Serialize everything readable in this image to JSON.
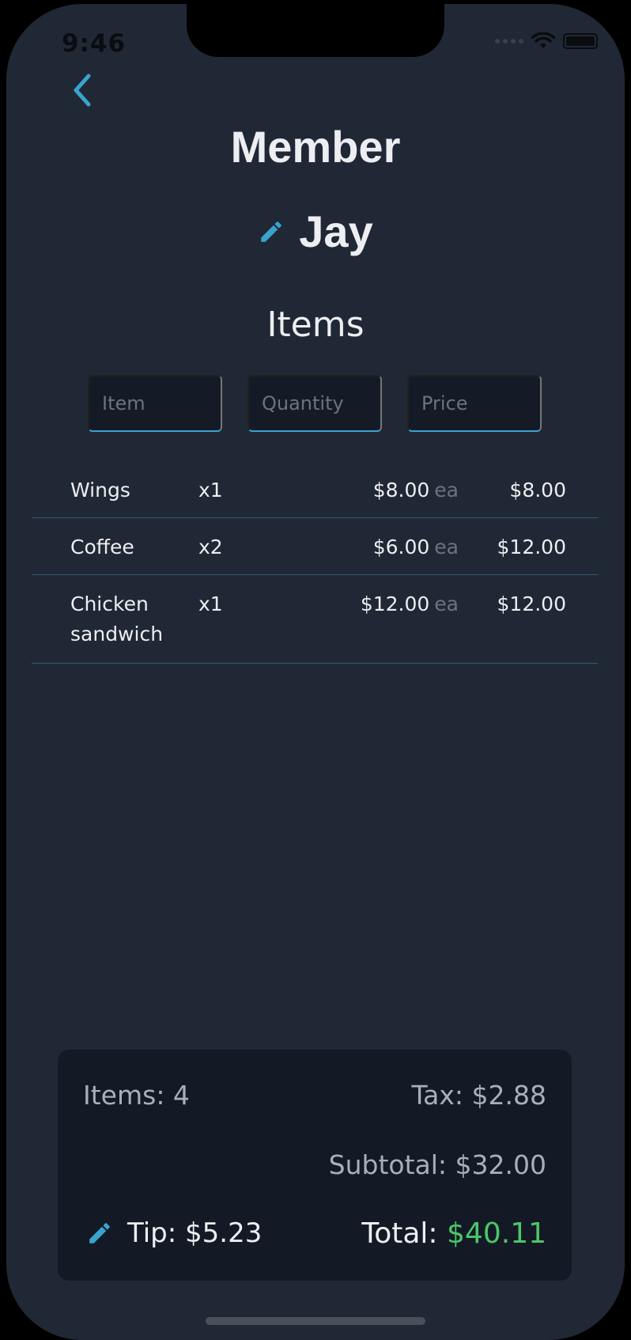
{
  "status": {
    "time": "9:46"
  },
  "header": {
    "title": "Member",
    "member_name": "Jay"
  },
  "items_section": {
    "title": "Items"
  },
  "inputs": {
    "item_placeholder": "Item",
    "quantity_placeholder": "Quantity",
    "price_placeholder": "Price"
  },
  "items": [
    {
      "name": "Wings",
      "qty": "x1",
      "price": "$8.00",
      "unit": "ea",
      "total": "$8.00"
    },
    {
      "name": "Coffee",
      "qty": "x2",
      "price": "$6.00",
      "unit": "ea",
      "total": "$12.00"
    },
    {
      "name": "Chicken sandwich",
      "qty": "x1",
      "price": "$12.00",
      "unit": "ea",
      "total": "$12.00"
    }
  ],
  "summary": {
    "items": "Items: 4",
    "tax": "Tax: $2.88",
    "subtotal": "Subtotal: $32.00",
    "tip": "Tip: $5.23",
    "total_label": "Total:",
    "total_value": "$40.11"
  },
  "colors": {
    "accent": "#3aa3cf",
    "background": "#212835",
    "panel": "#141a25",
    "total": "#4cc66a"
  },
  "icons": {
    "back": "chevron-left-icon",
    "edit": "pencil-icon"
  }
}
